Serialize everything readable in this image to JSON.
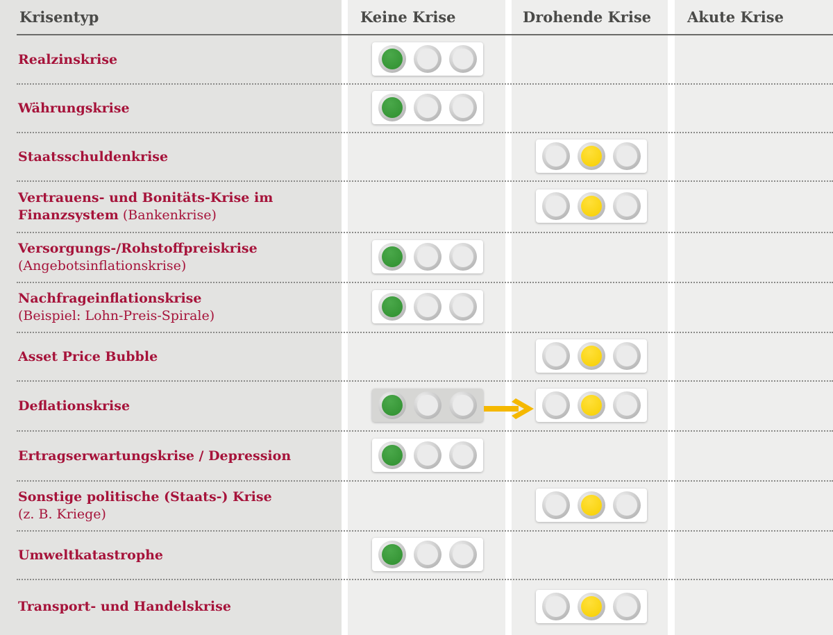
{
  "header": {
    "krisentyp": "Krisentyp",
    "keine": "Keine Krise",
    "drohend": "Drohende Krise",
    "akut": "Akute Krise"
  },
  "colors": {
    "label": "#a6133a",
    "green": "#2f8f2f",
    "yellow": "#f7cf00",
    "arrow": "#f5b800"
  },
  "rows": [
    {
      "title": "Realzinskrise",
      "sub": "",
      "status": "keine"
    },
    {
      "title": "Währungskrise",
      "sub": "",
      "status": "keine"
    },
    {
      "title": "Staatsschuldenkrise",
      "sub": "",
      "status": "drohend"
    },
    {
      "title": "Vertrauens- und Bonitäts-Krise im Finanzsystem",
      "sub": "(Bankenkrise)",
      "status": "drohend"
    },
    {
      "title": "Versorgungs-/Rohstoffpreiskrise",
      "sub": "(Angebotsinflationskrise)",
      "status": "keine"
    },
    {
      "title": "Nachfrageinflationskrise",
      "sub": "(Beispiel: Lohn-Preis-Spirale)",
      "status": "keine"
    },
    {
      "title": "Asset Price Bubble",
      "sub": "",
      "status": "drohend"
    },
    {
      "title": "Deflationskrise",
      "sub": "",
      "status": "drohend",
      "previous": "keine"
    },
    {
      "title": "Ertragserwartungskrise / Depression",
      "sub": "",
      "status": "keine"
    },
    {
      "title": "Sonstige politische (Staats-) Krise",
      "sub": "(z. B. Kriege)",
      "status": "drohend"
    },
    {
      "title": "Umweltkatastrophe",
      "sub": "",
      "status": "keine"
    },
    {
      "title": "Transport- und Handelskrise",
      "sub": "",
      "status": "drohend"
    }
  ]
}
